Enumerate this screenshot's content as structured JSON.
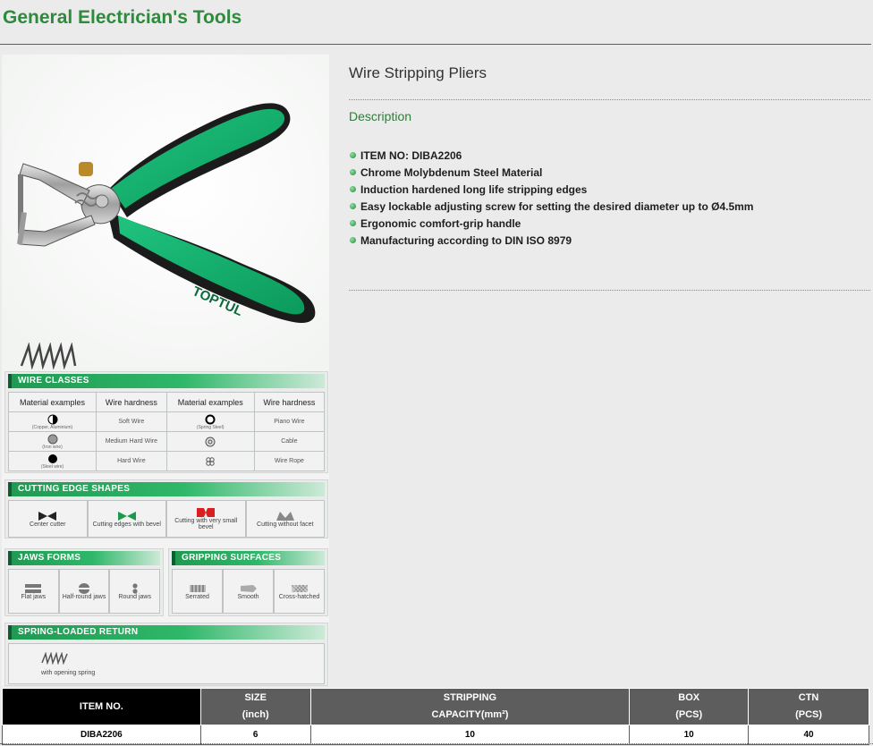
{
  "page": {
    "title": "General Electrician's Tools"
  },
  "product": {
    "name": "Wire Stripping Pliers",
    "description_heading": "Description",
    "features": [
      "ITEM NO: DIBA2206",
      "Chrome Molybdenum Steel Material",
      "Induction hardened long life stripping edges",
      "Easy lockable adjusting screw for setting the desired diameter up to Ø4.5mm",
      "Ergonomic comfort-grip handle",
      "Manufacturing according to DIN ISO 8979"
    ],
    "image": {
      "brand_mark": "TOPTUL",
      "colors": {
        "handle": "#17b573",
        "grip": "#1a1a1a",
        "jaw": "#b9b9b9"
      }
    }
  },
  "info_panel": {
    "wire_classes": {
      "title": "WIRE CLASSES",
      "headers": [
        "Material examples",
        "Wire hardness",
        "Material examples",
        "Wire hardness"
      ],
      "rows": [
        {
          "mat1": "(Copper, Aluminium)",
          "hard1": "Soft Wire",
          "mat2": "(Spring Steel)",
          "hard2": "Piano Wire"
        },
        {
          "mat1": "(Iron wire)",
          "hard1": "Medium Hard Wire",
          "mat2": "",
          "hard2": "Cable"
        },
        {
          "mat1": "(Steel wire)",
          "hard1": "Hard Wire",
          "mat2": "",
          "hard2": "Wire Rope"
        }
      ]
    },
    "cutting_edge_shapes": {
      "title": "CUTTING EDGE SHAPES",
      "items": [
        "Center cutter",
        "Cutting edges with bevel",
        "Cutting with very small bevel",
        "Cutting without facet"
      ]
    },
    "jaws_forms": {
      "title": "JAWS FORMS",
      "items": [
        "Flat jaws",
        "Half-round jaws",
        "Round jaws"
      ]
    },
    "gripping_surfaces": {
      "title": "GRIPPING SURFACES",
      "items": [
        "Serrated",
        "Smooth",
        "Cross-hatched"
      ]
    },
    "spring_loaded_return": {
      "title": "SPRING-LOADED RETURN",
      "label": "with opening spring"
    }
  },
  "spec_table": {
    "headers": [
      {
        "line1": "ITEM NO.",
        "line2": ""
      },
      {
        "line1": "SIZE",
        "line2": "(inch)"
      },
      {
        "line1": "STRIPPING",
        "line2": "CAPACITY(mm²)"
      },
      {
        "line1": "BOX",
        "line2": "(PCS)"
      },
      {
        "line1": "CTN",
        "line2": "(PCS)"
      }
    ],
    "rows": [
      {
        "item_no": "DIBA2206",
        "size": "6",
        "capacity": "10",
        "box": "10",
        "ctn": "40"
      }
    ]
  }
}
